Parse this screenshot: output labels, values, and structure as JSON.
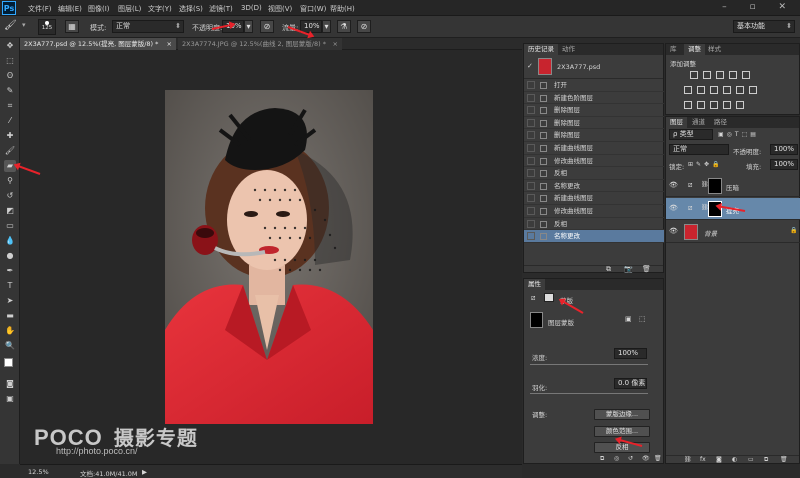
{
  "menu": {
    "logo": "Ps",
    "items": [
      "文件(F)",
      "编辑(E)",
      "图像(I)",
      "图层(L)",
      "文字(Y)",
      "选择(S)",
      "滤镜(T)",
      "3D(D)",
      "视图(V)",
      "窗口(W)",
      "帮助(H)"
    ],
    "window_controls": "– ▫ ✕"
  },
  "options": {
    "brush_size": "125",
    "mode_label": "模式:",
    "mode_value": "正常",
    "opacity_label": "不透明度:",
    "opacity_value": "10%",
    "flow_label": "流量:",
    "flow_value": "10%",
    "workspace": "基本功能"
  },
  "tabs": [
    {
      "label": "2X3A777.psd @ 12.5%(提亮, 图层蒙版/8) *",
      "close": "×"
    },
    {
      "label": "2X3A7774.JPG @ 12.5%(曲线 2, 图层蒙版/8) *",
      "close": "×"
    }
  ],
  "status": {
    "zoom": "12.5%",
    "doc": "文档:41.0M/41.0M"
  },
  "watermark": {
    "brand": "POCO",
    "title": "摄影专题",
    "url": "http://photo.poco.cn/"
  },
  "history": {
    "tabs": [
      "历史记录",
      "动作"
    ],
    "snapshot": "2X3A777.psd",
    "items": [
      "打开",
      "新建色阶图层",
      "删除图层",
      "删除图层",
      "删除图层",
      "新建曲线图层",
      "修改曲线图层",
      "反相",
      "名称更改",
      "新建曲线图层",
      "修改曲线图层",
      "反相",
      "名称更改"
    ],
    "selected_index": 12
  },
  "adjustments": {
    "tabs": [
      "库",
      "调整",
      "样式"
    ],
    "title": "添加调整"
  },
  "layers": {
    "tabs": [
      "图层",
      "通道",
      "路径"
    ],
    "filter": "ρ 类型",
    "blend": "正常",
    "opacity_label": "不透明度:",
    "opacity_value": "100%",
    "lock_label": "锁定:",
    "fill_label": "填充:",
    "fill_value": "100%",
    "rows": [
      {
        "name": "压暗",
        "selected": false
      },
      {
        "name": "提亮",
        "selected": true
      },
      {
        "name": "背景",
        "selected": false
      }
    ]
  },
  "properties": {
    "tab": "属性",
    "mask_label": "蒙版",
    "layer_mask": "图层蒙版",
    "density_label": "浓度:",
    "density_value": "100%",
    "feather_label": "羽化:",
    "feather_value": "0.0 像素",
    "adjust_label": "调整:",
    "btn_edge": "蒙版边缘...",
    "btn_color": "颜色范围...",
    "btn_invert": "反相"
  }
}
